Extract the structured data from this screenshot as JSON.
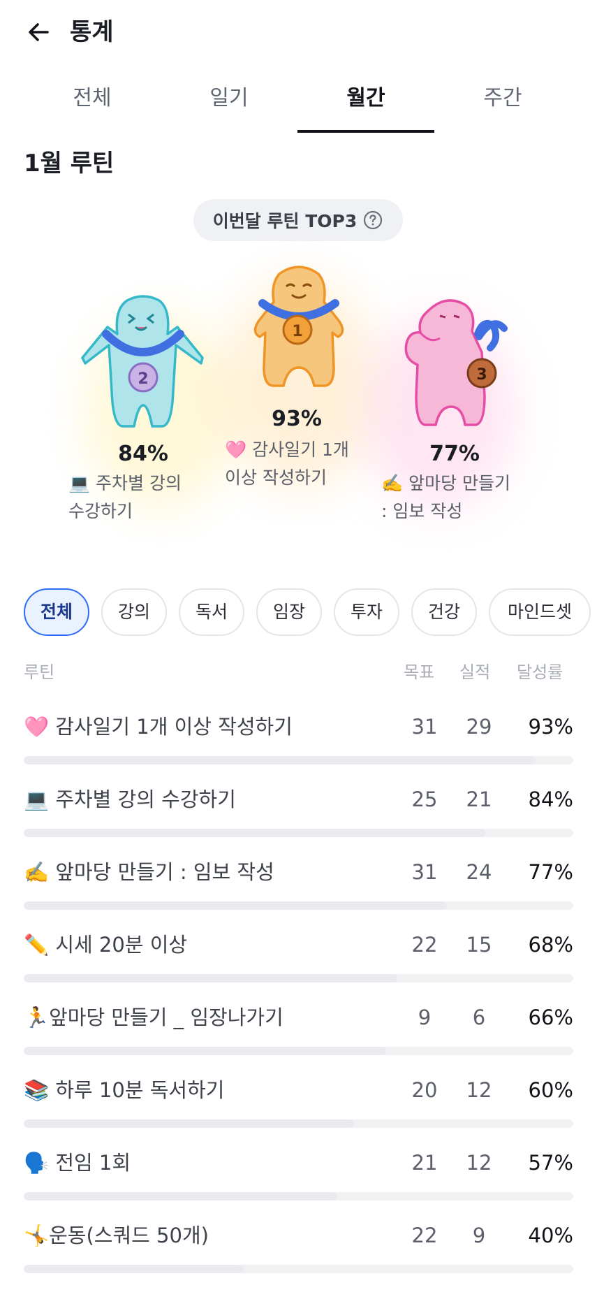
{
  "header": {
    "title": "통계",
    "back_icon": "arrow-left-icon"
  },
  "tabs": [
    {
      "label": "전체",
      "active": false
    },
    {
      "label": "일기",
      "active": false
    },
    {
      "label": "월간",
      "active": true
    },
    {
      "label": "주간",
      "active": false
    }
  ],
  "month_title": "1월 루틴",
  "top3": {
    "pill_label": "이번달 루틴 TOP3",
    "help_icon": "question-circle-icon",
    "ranks": [
      {
        "rank": "2",
        "percent": "84%",
        "name_line1": "💻 주차별 강의",
        "name_line2": "수강하기",
        "color": "#4fc6d3"
      },
      {
        "rank": "1",
        "percent": "93%",
        "name_line1": "🩷 감사일기 1개",
        "name_line2": "이상 작성하기",
        "color": "#f2a33a"
      },
      {
        "rank": "3",
        "percent": "77%",
        "name_line1": "✍️ 앞마당 만들기",
        "name_line2": ": 임보 작성",
        "color": "#ee6fb8"
      }
    ]
  },
  "filters": [
    {
      "label": "전체",
      "active": true
    },
    {
      "label": "강의",
      "active": false
    },
    {
      "label": "독서",
      "active": false
    },
    {
      "label": "임장",
      "active": false
    },
    {
      "label": "투자",
      "active": false
    },
    {
      "label": "건강",
      "active": false
    },
    {
      "label": "마인드셋",
      "active": false
    }
  ],
  "table": {
    "headers": {
      "routine": "루틴",
      "goal": "목표",
      "done": "실적",
      "rate": "달성률"
    },
    "rows": [
      {
        "label": "🩷 감사일기 1개 이상 작성하기",
        "goal": "31",
        "done": "29",
        "rate": "93%",
        "progress": 0.93
      },
      {
        "label": "💻 주차별 강의 수강하기",
        "goal": "25",
        "done": "21",
        "rate": "84%",
        "progress": 0.84
      },
      {
        "label": "✍️ 앞마당 만들기 : 임보 작성",
        "goal": "31",
        "done": "24",
        "rate": "77%",
        "progress": 0.77
      },
      {
        "label": "✏️ 시세 20분 이상",
        "goal": "22",
        "done": "15",
        "rate": "68%",
        "progress": 0.68
      },
      {
        "label": "🏃앞마당 만들기 _ 임장나가기",
        "goal": "9",
        "done": "6",
        "rate": "66%",
        "progress": 0.66
      },
      {
        "label": "📚 하루 10분 독서하기",
        "goal": "20",
        "done": "12",
        "rate": "60%",
        "progress": 0.6
      },
      {
        "label": "🗣️ 전임 1회",
        "goal": "21",
        "done": "12",
        "rate": "57%",
        "progress": 0.57
      },
      {
        "label": "🤸운동(스쿼드 50개)",
        "goal": "22",
        "done": "9",
        "rate": "40%",
        "progress": 0.4
      }
    ]
  }
}
